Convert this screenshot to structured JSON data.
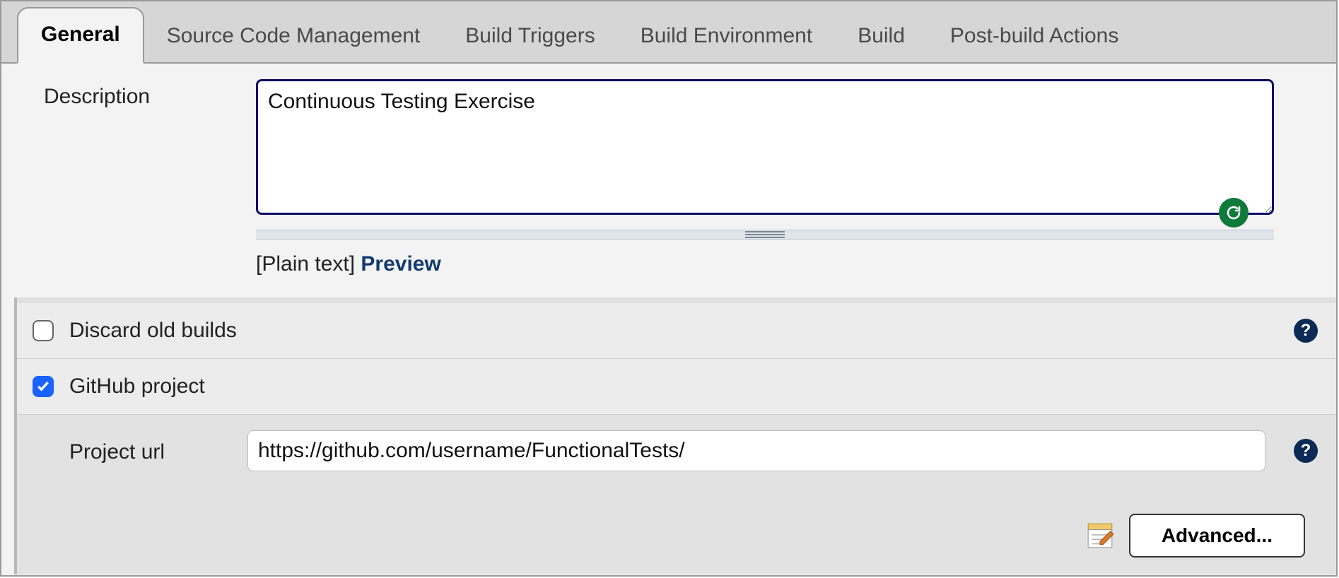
{
  "tabs": {
    "t0": "General",
    "t1": "Source Code Management",
    "t2": "Build Triggers",
    "t3": "Build Environment",
    "t4": "Build",
    "t5": "Post-build Actions"
  },
  "general": {
    "description_label": "Description",
    "description_value": "Continuous Testing Exercise",
    "plain_text_label": "[Plain text] ",
    "preview_label": "Preview"
  },
  "options": {
    "discard_label": "Discard old builds",
    "github_label": "GitHub project",
    "github_checked": true,
    "project_url_label": "Project url",
    "project_url_value": "https://github.com/username/FunctionalTests/",
    "advanced_label": "Advanced..."
  },
  "help_glyph": "?"
}
